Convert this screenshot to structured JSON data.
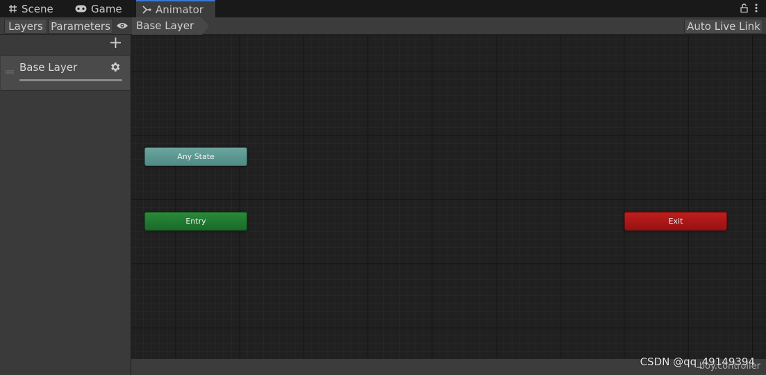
{
  "tabs": [
    {
      "label": "Scene",
      "icon": "grid-icon"
    },
    {
      "label": "Game",
      "icon": "gamepad-icon"
    },
    {
      "label": "Animator",
      "icon": "animator-icon",
      "active": true
    }
  ],
  "toolbar": {
    "layers_label": "Layers",
    "parameters_label": "Parameters",
    "breadcrumb": "Base Layer",
    "auto_live_link_label": "Auto Live Link"
  },
  "layers_panel": {
    "layers": [
      {
        "name": "Base Layer"
      }
    ]
  },
  "graph": {
    "nodes": {
      "any_state": "Any State",
      "entry": "Entry",
      "exit": "Exit"
    }
  },
  "status": {
    "controller": "boy.controller"
  },
  "watermark": "CSDN @qq_49149394",
  "colors": {
    "accent_tab": "#3a78d6",
    "any_state": "#5e9a93",
    "entry": "#1f7a30",
    "exit": "#ab1818"
  }
}
